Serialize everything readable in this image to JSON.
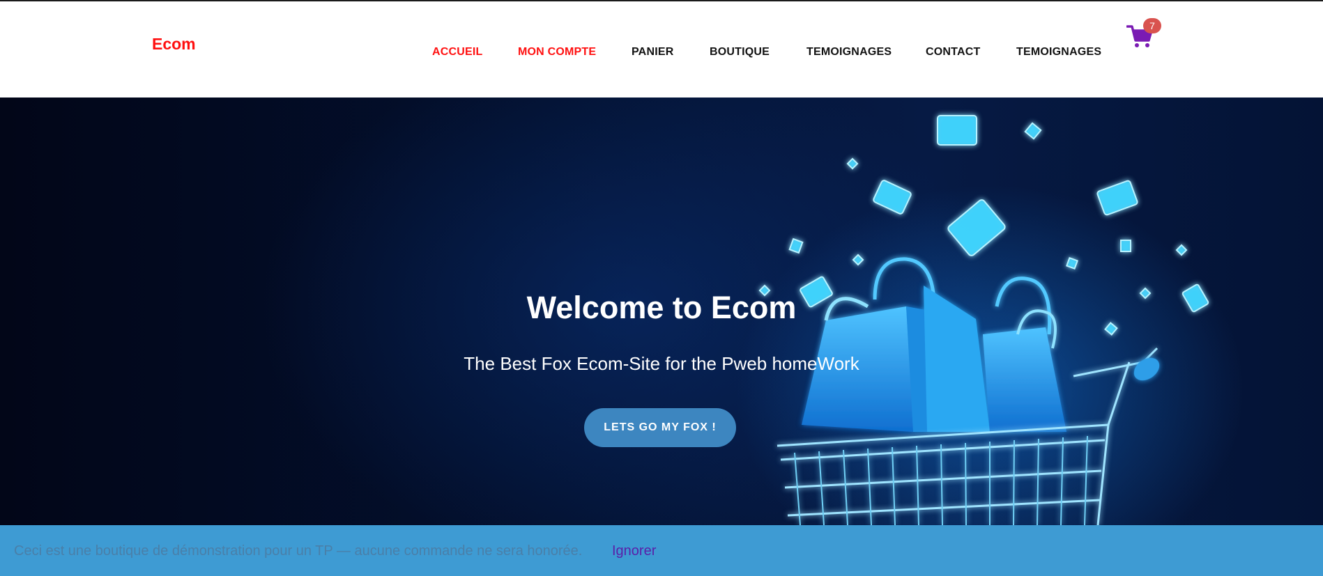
{
  "brand": {
    "name": "Ecom",
    "color": "#ff1010"
  },
  "nav": {
    "items": [
      {
        "label": "ACCUEIL",
        "active": true
      },
      {
        "label": "MON COMPTE",
        "active": true
      },
      {
        "label": "PANIER",
        "active": false
      },
      {
        "label": "BOUTIQUE",
        "active": false
      },
      {
        "label": "TEMOIGNAGES",
        "active": false
      },
      {
        "label": "CONTACT",
        "active": false
      },
      {
        "label": "TEMOIGNAGES",
        "active": false
      }
    ],
    "active_color": "#ff1010",
    "default_color": "#111111"
  },
  "cart": {
    "icon": "shopping-cart-icon",
    "count": "7",
    "icon_color": "#7a1bb3",
    "badge_color": "#d9534f"
  },
  "hero": {
    "title": "Welcome to Ecom",
    "subtitle": "The Best Fox Ecom-Site for the Pweb homeWork",
    "cta_label": "LETS GO MY FOX !",
    "image": "glowing-shopping-cart-with-bags-and-cards"
  },
  "notice": {
    "text": "Ceci est une boutique de démonstration pour un TP — aucune commande ne sera honorée.",
    "dismiss_label": "Ignorer",
    "background": "#3e9bd3"
  }
}
